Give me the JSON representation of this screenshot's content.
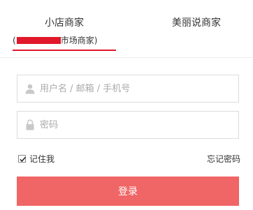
{
  "tabs": {
    "merchant": {
      "title": "小店商家",
      "subtitle_open": "(",
      "subtitle_rest": "市场商家)",
      "active": true
    },
    "beauty": {
      "title": "美丽说商家",
      "active": false
    }
  },
  "form": {
    "username_placeholder": "用户名 / 邮箱 / 手机号",
    "username_value": "",
    "password_placeholder": "密码",
    "password_value": "",
    "remember_label": "记住我",
    "remember_checked": true,
    "forgot_label": "忘记密码",
    "login_label": "登录"
  },
  "icons": {
    "user": "user-icon",
    "lock": "lock-icon",
    "check": "check-icon"
  },
  "colors": {
    "accent": "#e0182a",
    "login_button": "#f06565",
    "border": "#dcdcdc",
    "placeholder": "#aaaaaa"
  }
}
